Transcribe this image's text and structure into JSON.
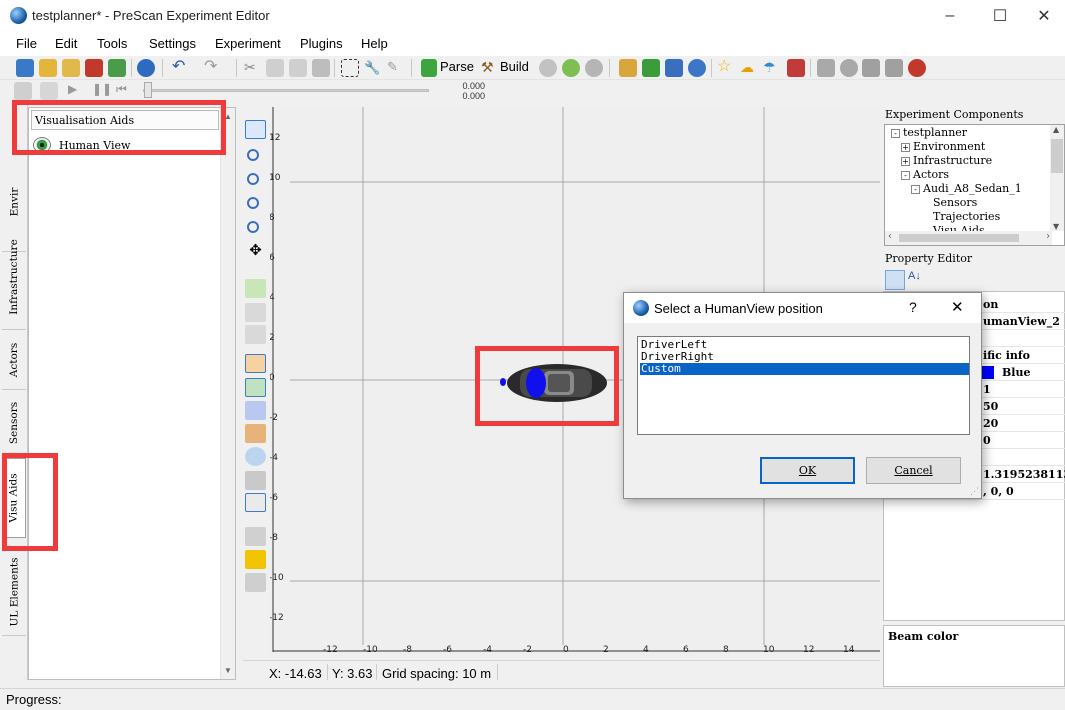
{
  "window": {
    "title": "testplanner* - PreScan Experiment Editor",
    "controls": [
      "–",
      "☐",
      "✕"
    ]
  },
  "menu": [
    "File",
    "Edit",
    "Tools",
    "Settings",
    "Experiment",
    "Plugins",
    "Help"
  ],
  "toolbar": {
    "parse_label": "Parse",
    "build_label": "Build"
  },
  "playback": {
    "time_top": "0.000",
    "time_bottom": "0.000"
  },
  "left_tabs": [
    "Environment",
    "Infrastructure",
    "Actors",
    "Sensors",
    "Visu Aids",
    "UL Elements"
  ],
  "left_tabs_visible": [
    "Envir",
    "Infrastructure",
    "Actors",
    "Sensors",
    "Visu Aids",
    "UL Elements"
  ],
  "left_panel": {
    "header": "Visualisation Aids",
    "items": [
      {
        "label": "Human View",
        "icon": "eye-icon"
      }
    ]
  },
  "canvas": {
    "y_ticks": [
      "12",
      "10",
      "8",
      "6",
      "4",
      "2",
      "0",
      "-2",
      "-4",
      "-6",
      "-8",
      "-10",
      "-12"
    ],
    "x_ticks": [
      "-12",
      "-10",
      "-8",
      "-6",
      "-4",
      "-2",
      "0",
      "2",
      "4",
      "6",
      "8",
      "10",
      "12",
      "14"
    ]
  },
  "status": {
    "x": "X: -14.63",
    "y": "Y: 3.63",
    "grid": "Grid spacing: 10 m"
  },
  "right_panel": {
    "components_title": "Experiment Components",
    "tree": [
      {
        "label": "testplanner",
        "level": 0,
        "toggle": "-"
      },
      {
        "label": "Environment",
        "level": 1,
        "toggle": "+"
      },
      {
        "label": "Infrastructure",
        "level": 1,
        "toggle": "+"
      },
      {
        "label": "Actors",
        "level": 1,
        "toggle": "-"
      },
      {
        "label": "Audi_A8_Sedan_1",
        "level": 2,
        "toggle": "-"
      },
      {
        "label": "Sensors",
        "level": 3,
        "toggle": ""
      },
      {
        "label": "Trajectories",
        "level": 3,
        "toggle": ""
      },
      {
        "label": "Visu Aids",
        "level": 3,
        "toggle": ""
      }
    ],
    "property_title": "Property Editor",
    "properties": [
      {
        "name": "",
        "value": "on",
        "bold": true
      },
      {
        "name": "",
        "value": "umanView_2",
        "bold": true
      },
      {
        "name": "",
        "value": "",
        "bold": false
      },
      {
        "name": "",
        "value": "ific info",
        "bold": true
      },
      {
        "name": "",
        "value": "Blue",
        "bold": true,
        "swatch": "#0000ff"
      },
      {
        "name": "",
        "value": "1",
        "bold": true
      },
      {
        "name": "",
        "value": "50",
        "bold": true
      },
      {
        "name": "",
        "value": "20",
        "bold": true
      },
      {
        "name": "",
        "value": "0",
        "bold": true
      },
      {
        "name": "",
        "value": "",
        "bold": false
      },
      {
        "name": "",
        "value": "1.3195238113",
        "bold": true
      },
      {
        "name": "",
        "value": ", 0, 0",
        "bold": true
      }
    ],
    "description": "Beam color"
  },
  "progress_label": "Progress:",
  "dialog": {
    "title": "Select a HumanView position",
    "help": "?",
    "close": "✕",
    "options": [
      "DriverLeft",
      "DriverRight",
      "Custom"
    ],
    "selected_index": 2,
    "ok_label": "OK",
    "cancel_label": "Cancel"
  },
  "colors": {
    "highlight": "#ef3b3b",
    "selection": "#0a64c8",
    "viewcone": "#1010ee"
  }
}
